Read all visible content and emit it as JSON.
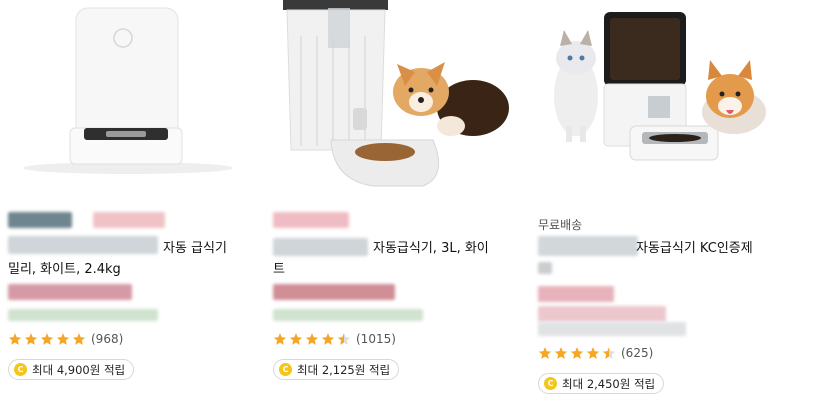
{
  "products": [
    {
      "shipping": "",
      "title_line1": "자동 급식기",
      "title_line2": "밀리, 화이트, 2.4kg",
      "review_count": "(968)",
      "rating": 5.0,
      "reward": "최대 4,900원 적립"
    },
    {
      "shipping": "",
      "title_line1": "자동급식기, 3L, 화이",
      "title_line2": "트",
      "review_count": "(1015)",
      "rating": 4.5,
      "reward": "최대 2,125원 적립"
    },
    {
      "shipping": "무료배송",
      "title_line1": "자동급식기 KC인증제",
      "title_line2": "",
      "review_count": "(625)",
      "rating": 4.5,
      "reward": "최대 2,450원 적립"
    }
  ],
  "colors": {
    "star": "#f5a623",
    "coin": "#f5c518"
  },
  "icons": {
    "rating": "star-icon",
    "reward": "coin-icon"
  }
}
